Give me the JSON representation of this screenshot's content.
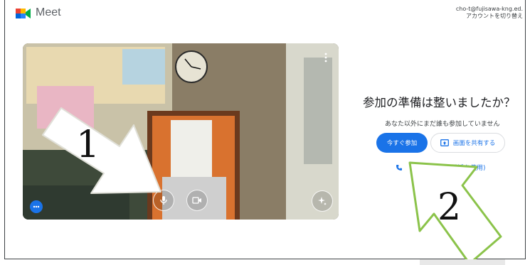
{
  "header": {
    "brand": "Meet",
    "account_email": "cho-t@fujisawa-kng.ed.",
    "switch_account": "アカウントを切り替え"
  },
  "main": {
    "title": "参加の準備は整いましたか？",
    "subtitle": "あなた以外にまだ誰も参加していません",
    "join_label": "今すぐ参加",
    "share_label": "画面を共有する",
    "phone_label": "電話を使用)"
  },
  "annotations": {
    "label_1": "1",
    "label_2": "2"
  },
  "colors": {
    "accent": "#1a73e8",
    "arrow_fill": "#ffffff",
    "arrow2_stroke": "#8bc34a"
  },
  "icons": {
    "mic": "mic-icon",
    "camera": "camera-icon",
    "effects": "sparkle-icon",
    "more": "more-vert-icon",
    "dots": "more-horiz-icon",
    "share": "present-screen-icon",
    "phone": "phone-icon"
  }
}
